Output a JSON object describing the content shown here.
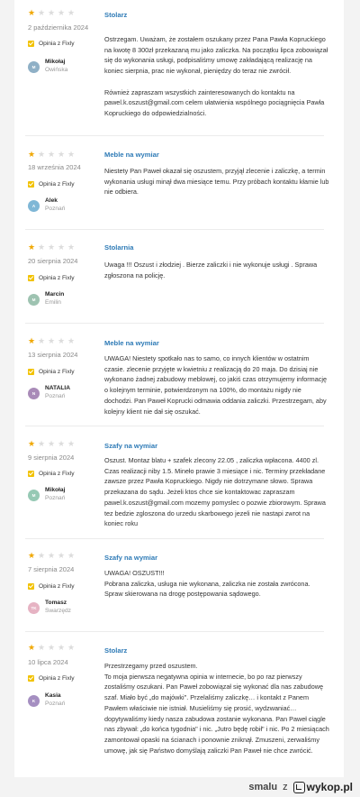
{
  "badge_label": "Opinia z Fixly",
  "reviews": [
    {
      "rating": 1,
      "date": "2 października 2024",
      "user": "Mikołaj",
      "location": "Owińska",
      "initials": "M",
      "avatar_color": "#8fb0c6",
      "category": "Stolarz",
      "text": "Ostrzegam. Uważam, że zostałem oszukany przez Pana Pawła Kopruckiego na kwotę 8 300zł przekazaną mu jako zaliczka. Na początku lipca zobowiązał się do wykonania usługi, podpisaliśmy umowę zakładającą realizację na koniec sierpnia, prac nie wykonał, pieniędzy do teraz nie zwrócił.\n\nRównież zapraszam wszystkich zainteresowanych do kontaktu na pawel.k.oszust@gmail.com celem ułatwienia wspólnego pociągnięcia Pawła Kopruckiego do odpowiedzialności."
    },
    {
      "rating": 1,
      "date": "18 września 2024",
      "user": "Alek",
      "location": "Poznań",
      "initials": "A",
      "avatar_color": "#7fb7d6",
      "category": "Meble na wymiar",
      "text": "Niestety Pan Paweł okazał się oszustem, przyjął zlecenie i zaliczkę, a termin wykonania usługi minął dwa miesiące temu. Przy próbach kontaktu kłamie lub nie odbiera."
    },
    {
      "rating": 1,
      "date": "20 sierpnia 2024",
      "user": "Marcin",
      "location": "Emilin",
      "initials": "M",
      "avatar_color": "#9ec3b1",
      "category": "Stolarnia",
      "text": "Uwaga !!! Oszust i złodziej . Bierze zaliczki i nie wykonuje usługi . Sprawa zgłoszona na policję."
    },
    {
      "rating": 1,
      "date": "13 sierpnia 2024",
      "user": "NATALIA",
      "location": "Poznań",
      "initials": "N",
      "avatar_color": "#a98bb8",
      "category": "Meble na wymiar",
      "text": "UWAGA! Niestety spotkało nas to samo, co innych klientów w ostatnim czasie. zlecenie przyjęte w kwietniu z realizacją do 20 maja. Do dzisiaj nie wykonano żadnej zabudowy meblowej, co jakiś czas otrzymujemy informację o kolejnym terminie, potwierdzonym na 100%, do montażu nigdy nie dochodzi. Pan Paweł Koprucki odmawia oddania zaliczki. Przestrzegam, aby kolejny klient nie dał się oszukać."
    },
    {
      "rating": 1,
      "date": "9 sierpnia 2024",
      "user": "Mikołaj",
      "location": "Poznań",
      "initials": "M",
      "avatar_color": "#96c9b4",
      "category": "Szafy na wymiar",
      "text": "Oszust. Montaz blatu + szafek zlecony 22.05 , zaliczka wpłacona. 4400 zl. Czas realizacji niby 1.5. Mineło prawie 3 miesiące i nic. Terminy przekładane zawsze przez Pawła Kopruckiego. Nigdy nie dotrzymane słowo. Sprawa przekazana do sądu. Jeżeli ktos chce sie kontaktowac zapraszam pawel.k.oszust@gmail.com mozemy pomyslec o pozwie zbiorowym. Sprawa tez bedzie zgloszona do urzedu skarbowego jezeli nie nastapi zwrot na koniec roku"
    },
    {
      "rating": 1,
      "date": "7 sierpnia 2024",
      "user": "Tomasz",
      "location": "Swarzędz",
      "initials": "TK",
      "avatar_color": "#e6b3c3",
      "category": "Szafy na wymiar",
      "text": "UWAGA! OSZUST!!!\nPobrana zaliczka, usługa nie wykonana, zaliczka nie została zwrócona. Spraw skierowana na drogę postępowania sądowego."
    },
    {
      "rating": 1,
      "date": "10 lipca 2024",
      "user": "Kasia",
      "location": "Poznań",
      "initials": "K",
      "avatar_color": "#a58fc1",
      "category": "Stolarz",
      "text": "Przestrzegamy przed oszustem.\nTo moja pierwsza negatywna opinia w internecie, bo po raz pierwszy zostaliśmy oszukani. Pan Paweł zobowiązał się wykonać dla nas zabudowę szaf. Miało być „do majówki\". Przelaliśmy zaliczkę… i kontakt z Panem Pawłem właściwie nie istniał. Musieliśmy się prosić, wydzwaniać… dopytywaliśmy kiedy nasza zabudowa zostanie wykonana. Pan Paweł ciągle nas zbywał: „do końca tygodnia\" i nic. „Jutro będę robił\" i nic. Po 2 miesiącach zamontował opaski na ścianach i ponownie zniknął. Zmuszeni, zerwaliśmy umowę, jak się Państwo domyślają zaliczki Pan Paweł nie chce zwrócić."
    }
  ],
  "footer": {
    "username": "smalu",
    "separator": "z",
    "site": "wykop.pl"
  }
}
